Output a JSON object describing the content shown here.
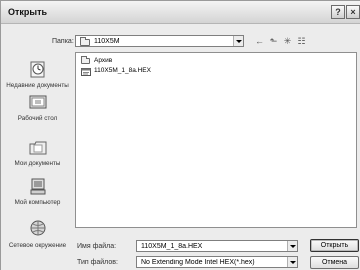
{
  "window": {
    "title": "Открыть",
    "help_glyph": "?",
    "close_glyph": "×"
  },
  "lookin": {
    "label": "Папка:",
    "value": "110X5M"
  },
  "toolbar": {
    "back_glyph": "←",
    "up_glyph": "⬑",
    "newfolder_glyph": "✳",
    "view_glyph": "☷"
  },
  "places": [
    {
      "label": "Недавние документы"
    },
    {
      "label": "Рабочий стол"
    },
    {
      "label": "Мои документы"
    },
    {
      "label": "Мой компьютер"
    },
    {
      "label": "Сетевое окружение"
    }
  ],
  "files": [
    {
      "name": "Архив",
      "type": "folder"
    },
    {
      "name": "110X5M_1_8a.HEX",
      "type": "file"
    }
  ],
  "filename": {
    "label": "Имя файла:",
    "value": "110X5M_1_8a.HEX"
  },
  "filetype": {
    "label": "Тип файлов:",
    "value": "No Extending Mode Intel HEX(*.hex)"
  },
  "buttons": {
    "open": "Открыть",
    "cancel": "Отмена"
  }
}
